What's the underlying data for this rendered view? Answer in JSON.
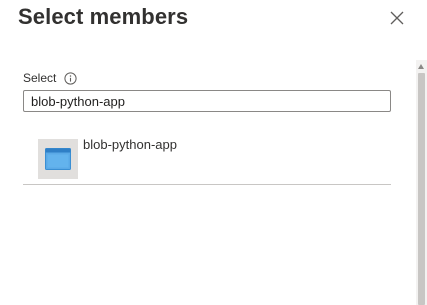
{
  "dialog": {
    "title": "Select members"
  },
  "select": {
    "label": "Select",
    "value": "blob-python-app"
  },
  "results": [
    {
      "name": "blob-python-app"
    }
  ],
  "icons": {
    "close": "close-icon",
    "info": "info-icon",
    "app": "app-registration-icon"
  },
  "colors": {
    "text": "#323130",
    "border": "#8a8886",
    "divider": "#c8c6c4",
    "app_icon": "#4ba0e0"
  }
}
